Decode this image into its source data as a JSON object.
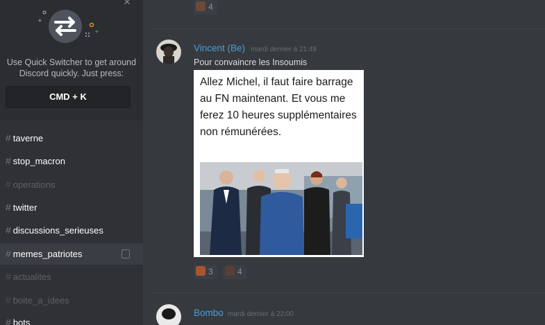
{
  "quick_switcher": {
    "close_glyph": "×",
    "hint": "Use Quick Switcher to get around Discord quickly. Just press:",
    "shortcut": "CMD + K",
    "icon": "swap-arrows-icon"
  },
  "channels": [
    {
      "label": "taverne",
      "state": "unread"
    },
    {
      "label": "stop_macron",
      "state": "unread"
    },
    {
      "label": "operations",
      "state": "muted"
    },
    {
      "label": "twitter",
      "state": "unread"
    },
    {
      "label": "discussions_serieuses",
      "state": "unread"
    },
    {
      "label": "memes_patriotes",
      "state": "selected"
    },
    {
      "label": "actualites",
      "state": "muted"
    },
    {
      "label": "boite_a_idees",
      "state": "muted"
    },
    {
      "label": "bots",
      "state": "unread"
    }
  ],
  "hash_glyph": "#",
  "top_reaction": {
    "count": "4"
  },
  "message": {
    "author": "Vincent (Be)",
    "timestamp": "mardi dernier à 21:48",
    "text": "Pour convaincre les Insoumis",
    "meme_caption": "Allez Michel, il faut faire barrage au FN maintenant. Et vous me ferez 10 heures supplémentaires non rémunérées.",
    "reactions": [
      {
        "count": "3"
      },
      {
        "count": "4"
      }
    ]
  },
  "next_message": {
    "author": "Bombo",
    "timestamp": "mardi dernier à 22:00"
  },
  "colors": {
    "background": "#36393e",
    "sidebar": "#2f3136",
    "author": "#4a9fd8"
  }
}
